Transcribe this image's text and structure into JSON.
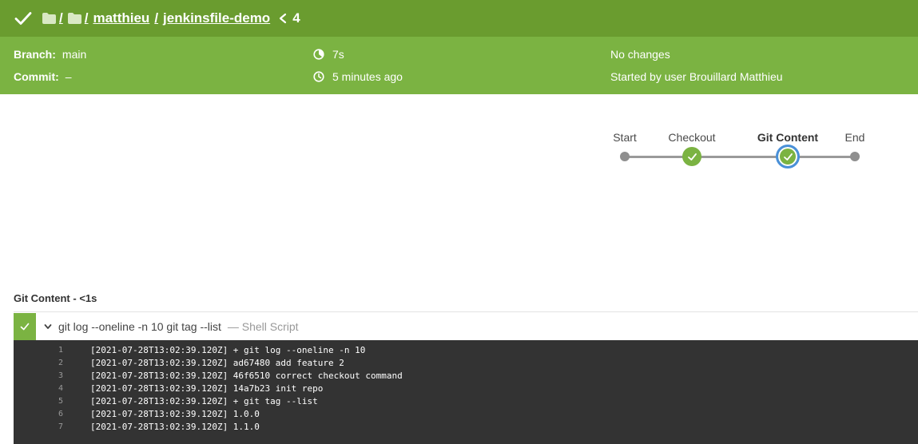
{
  "header": {
    "crumb_sep1": "/",
    "crumb_sep2": "/",
    "org": "matthieu",
    "sep3": "/",
    "repo": "jenkinsfile-demo",
    "run_number": "4"
  },
  "info": {
    "branch_label": "Branch:",
    "branch_value": "main",
    "commit_label": "Commit:",
    "commit_value": "–",
    "duration": "7s",
    "time_ago": "5 minutes ago",
    "changes": "No changes",
    "started_by": "Started by user Brouillard Matthieu"
  },
  "pipeline": {
    "stages": [
      {
        "label": "Start"
      },
      {
        "label": "Checkout"
      },
      {
        "label": "Git Content"
      },
      {
        "label": "End"
      }
    ]
  },
  "stage": {
    "title": "Git Content - <1s",
    "step_command": "git log --oneline -n 10 git tag --list",
    "step_type": "— Shell Script"
  },
  "console": [
    {
      "n": "1",
      "text": "[2021-07-28T13:02:39.120Z] + git log --oneline -n 10"
    },
    {
      "n": "2",
      "text": "[2021-07-28T13:02:39.120Z] ad67480 add feature 2"
    },
    {
      "n": "3",
      "text": "[2021-07-28T13:02:39.120Z] 46f6510 correct checkout command"
    },
    {
      "n": "4",
      "text": "[2021-07-28T13:02:39.120Z] 14a7b23 init repo"
    },
    {
      "n": "5",
      "text": "[2021-07-28T13:02:39.120Z] + git tag --list"
    },
    {
      "n": "6",
      "text": "[2021-07-28T13:02:39.120Z] 1.0.0"
    },
    {
      "n": "7",
      "text": "[2021-07-28T13:02:39.120Z] 1.1.0"
    }
  ],
  "colors": {
    "header_green": "#6a9c2f",
    "info_green": "#7bb342",
    "success": "#7bb342",
    "selected_ring": "#4a90d9",
    "console_bg": "#333333"
  }
}
